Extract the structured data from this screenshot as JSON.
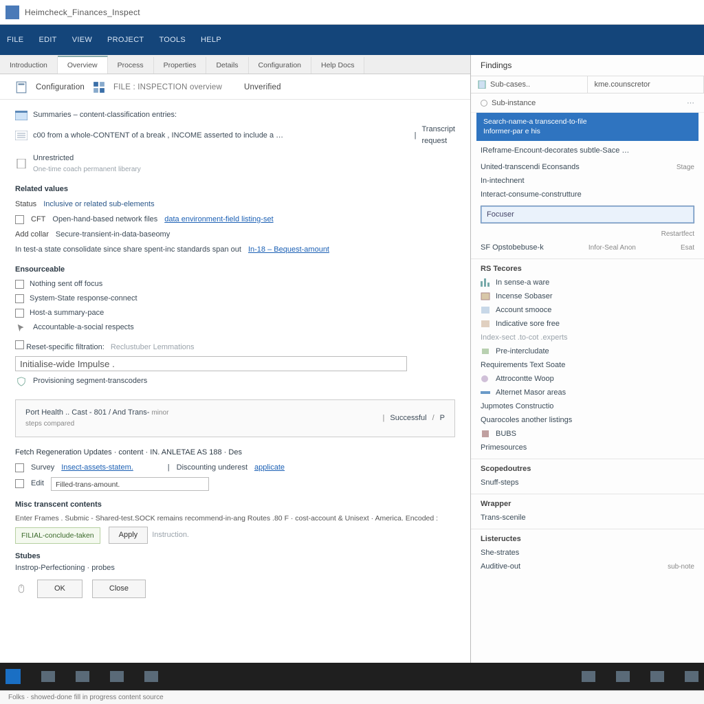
{
  "window": {
    "title": "Heimcheck_Finances_Inspect"
  },
  "menubar": [
    "FILE",
    "EDIT",
    "VIEW",
    "PROJECT",
    "TOOLS",
    "HELP"
  ],
  "tabs": [
    {
      "label": "Introduction",
      "active": false
    },
    {
      "label": "Overview",
      "active": true
    },
    {
      "label": "Process",
      "active": false
    },
    {
      "label": "Properties",
      "active": false
    },
    {
      "label": "Details",
      "active": false
    },
    {
      "label": "Configuration",
      "active": false
    },
    {
      "label": "Help Docs",
      "active": false
    }
  ],
  "header": {
    "breadcrumb": "Configuration",
    "subtitle": "FILE : INSPECTION overview",
    "tag": "Unverified"
  },
  "body": {
    "line1": "Summaries – content-classification entries:",
    "line2_a": "c00 from a whole-CONTENT of a break , INCOME asserted to include a …",
    "line2_b": "Transcript request",
    "line3_t": "Unrestricted",
    "line3_d": "One-time coach permanent liberary",
    "sec_params": "Related values",
    "p_status_l": "Status",
    "p_status_v": "Inclusive or related sub-elements",
    "p_cft_l": "CFT",
    "p_cft_v": "Open-hand-based network files",
    "p_cft_lnk": "data environment-field listing-set",
    "p_add_l": "Add collar",
    "p_add_v": "Secure-transient-in-data-baseomy",
    "p_art": "In test-a state consolidate since share spent-inc standards span out",
    "p_art_lnk": "In-18 – Bequest-amount",
    "sec_assert": "Ensourceable",
    "a1": "Nothing sent off focus",
    "a2": "System-State response-connect",
    "a3": "Host-a summary-pace",
    "a4": "Accountable-a-social respects",
    "chk_lbl": "Reset-specific filtration:",
    "chk_sub": "Reclustuber Lemmations",
    "field_val": "Initialise-wide Impulse .",
    "proc_lbl": "Provisioning segment-transcoders",
    "panel_l": "Port Health .. Cast - 801 / And Trans-",
    "panel_m": "minor",
    "panel_r": "Successful",
    "panel_p": "P",
    "panel_sub": "steps compared",
    "rel_title": "Fetch Regeneration Updates · content · IN. ANLETAE AS 188 · Des",
    "rel_r1_l": "Survey",
    "rel_r1_v": "Insect-assets-statem.",
    "rel_r1_r": "Discounting underest",
    "rel_r1_rlnk": "applicate",
    "rel_r2_l": "Edit",
    "rel_r2_v": "Filled-trans-amount.",
    "ms_title": "Misc transcent contents",
    "ms_line": "Enter Frames . Submic ‑ Shared-test.SOCK remains recommend-in-ang Routes .80 F · cost-account & Unisext · America. Encoded :",
    "ms_green": "FILIAL-conclude-taken",
    "ms_btn": "Apply",
    "ms_after": "Instruction.",
    "sh_title": "Stubes",
    "sh_line": "Instrop-Perfectioning · probes",
    "btn_ok": "OK",
    "btn_close": "Close"
  },
  "rpanel": {
    "title": "Findings",
    "search1": "Sub-cases..",
    "search2": "kme.counscretor",
    "filter": "Sub-instance",
    "sel_l1": "Search-name-a transcend-to-file",
    "sel_l2": "Informer-par e his",
    "after_sel": "IReframe-Encount-decorates subtle-Sace …",
    "i1": "United-transcendi Econsands",
    "i1_r": "Stage",
    "i2": "In-intechnent",
    "i3": "Interact-consume-construtture",
    "input": "Focuser",
    "input_note": "Restartfect",
    "i4": "SF  Opstobebuse-k",
    "i4_r": "Infor-Seal Anon",
    "i4_r2": "Esat",
    "sec_r": "RS  Tecores",
    "r1": "In sense-a ware",
    "r2": "Incense Sobaser",
    "r3": "Account smooce",
    "r4": "Indicative sore free",
    "r5": "Index-sect .to-cot .experts",
    "r6": "Pre-intercludate",
    "r7": "Requirements Text Soate",
    "r8": "Attrocontte Woop",
    "r9": "Alternet Masor areas",
    "r10": "Jupmotes Constructio",
    "r11": "Quarocoles another listings",
    "r12": "BUBS",
    "r13": "Primesources",
    "sec_s": "Scopedoutres",
    "s1": "Snuff-steps",
    "sec_m": "Wrapper",
    "m1": "Trans-scenile",
    "sec_l": "Listeructes",
    "l1": "She-strates",
    "l2": "Auditive-out",
    "l2_note": "sub-note"
  },
  "statusbar": "Folks · showed-done fill in progress content source"
}
